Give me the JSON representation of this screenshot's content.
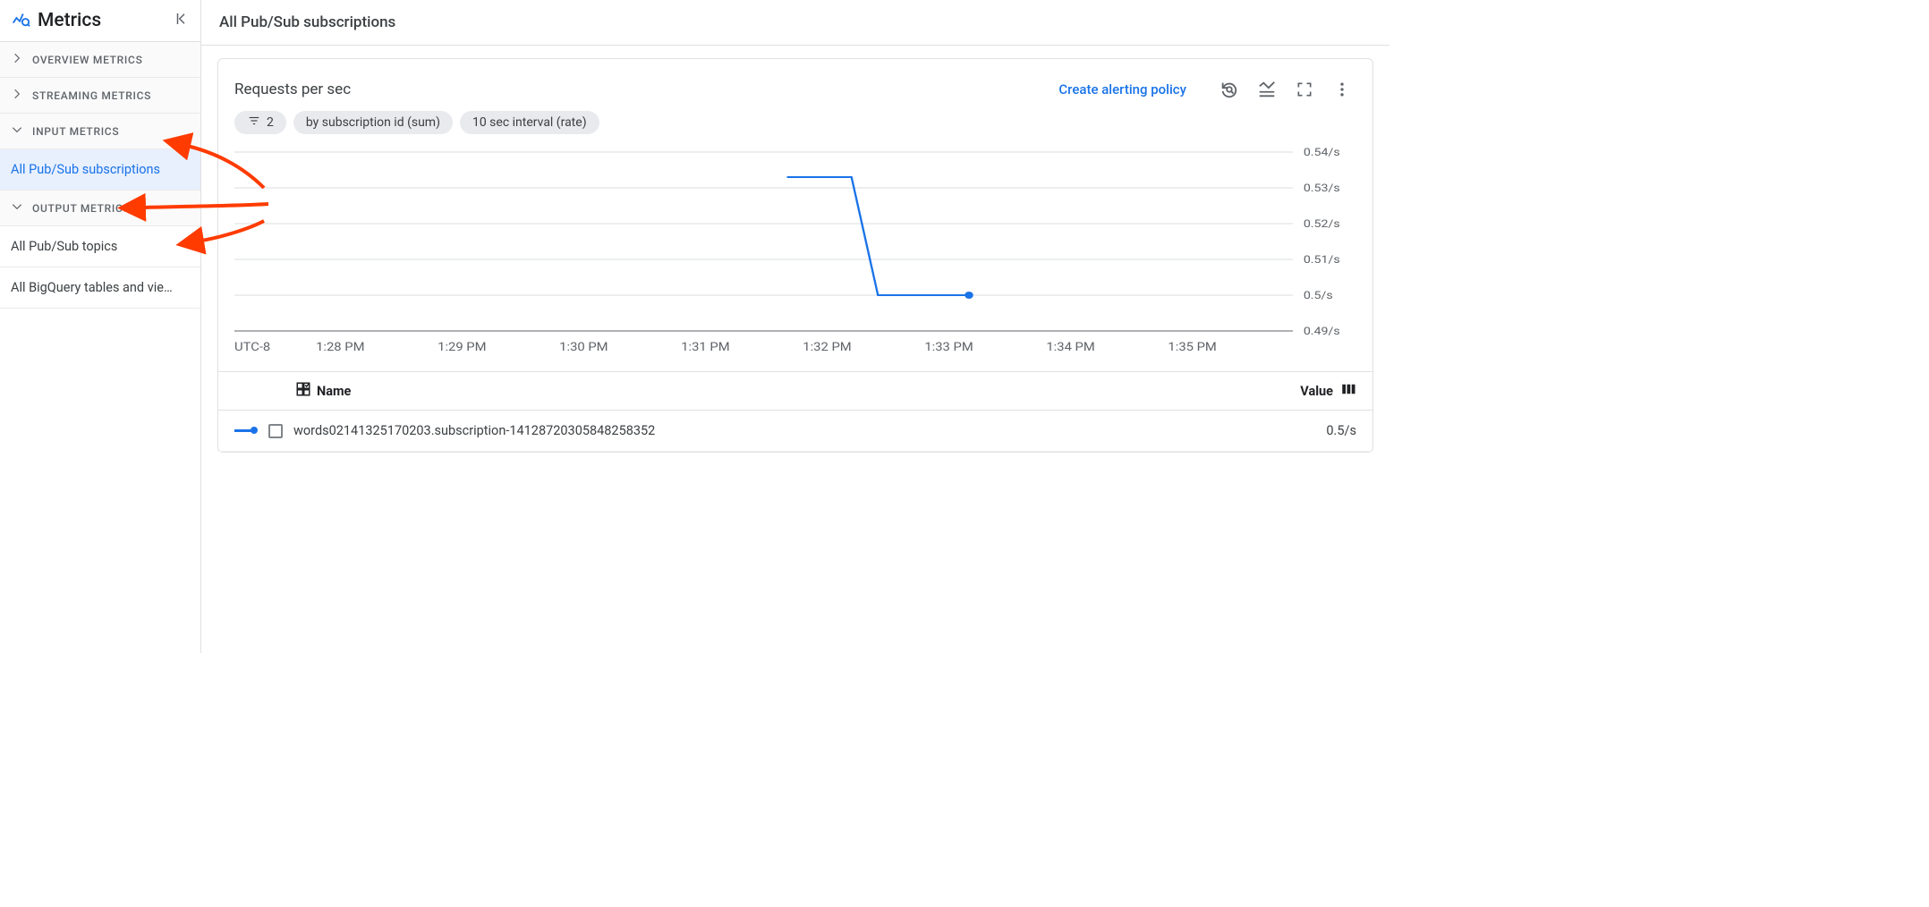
{
  "sidebar": {
    "title": "Metrics",
    "sections": [
      {
        "label": "OVERVIEW METRICS",
        "expanded": false,
        "items": []
      },
      {
        "label": "STREAMING METRICS",
        "expanded": false,
        "items": []
      },
      {
        "label": "INPUT METRICS",
        "expanded": true,
        "items": [
          {
            "label": "All Pub/Sub subscriptions",
            "active": true
          }
        ]
      },
      {
        "label": "OUTPUT METRICS",
        "expanded": true,
        "items": [
          {
            "label": "All Pub/Sub topics",
            "active": false
          },
          {
            "label": "All BigQuery tables and vie…",
            "active": false
          }
        ]
      }
    ]
  },
  "page_title": "All Pub/Sub subscriptions",
  "card": {
    "title": "Requests per sec",
    "alert_link": "Create alerting policy",
    "chips": {
      "filter": "2",
      "agg": "by subscription id (sum)",
      "interval": "10 sec interval (rate)"
    }
  },
  "chart_data": {
    "type": "line",
    "xlabel": "UTC-8",
    "ylabel": "",
    "y_ticks": [
      "0.54/s",
      "0.53/s",
      "0.52/s",
      "0.51/s",
      "0.5/s",
      "0.49/s"
    ],
    "y_values": [
      0.54,
      0.53,
      0.52,
      0.51,
      0.5,
      0.49
    ],
    "x_ticks": [
      "1:28 PM",
      "1:29 PM",
      "1:30 PM",
      "1:31 PM",
      "1:32 PM",
      "1:33 PM",
      "1:34 PM",
      "1:35 PM"
    ],
    "series": [
      {
        "name": "words02141325170203.subscription-14128720305848258352",
        "points": [
          {
            "x": "1:31:40 PM",
            "y": 0.533
          },
          {
            "x": "1:32:12 PM",
            "y": 0.533
          },
          {
            "x": "1:32:25 PM",
            "y": 0.5
          },
          {
            "x": "1:33:10 PM",
            "y": 0.5
          }
        ]
      }
    ]
  },
  "table": {
    "columns": {
      "name": "Name",
      "value": "Value"
    },
    "rows": [
      {
        "name": "words02141325170203.subscription-14128720305848258352",
        "value": "0.5/s"
      }
    ]
  }
}
